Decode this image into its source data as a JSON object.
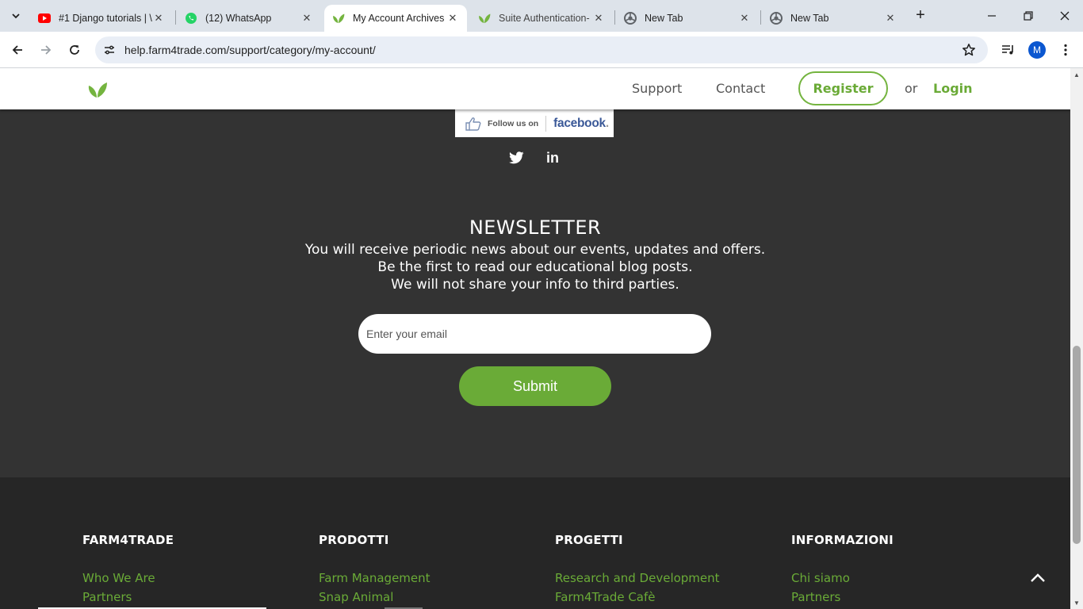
{
  "browser": {
    "tabs": [
      {
        "label": "#1 Django tutorials | \\",
        "icon": "youtube-icon"
      },
      {
        "label": "(12) WhatsApp",
        "icon": "whatsapp-icon"
      },
      {
        "label": "My Account Archives",
        "icon": "farm4trade-leaf-icon",
        "active": true
      },
      {
        "label": "Suite Authentication-",
        "icon": "farm4trade-leaf-icon"
      },
      {
        "label": "New Tab",
        "icon": "chrome-icon"
      },
      {
        "label": "New Tab",
        "icon": "chrome-icon"
      }
    ],
    "url": "help.farm4trade.com/support/category/my-account/",
    "profile_initial": "M"
  },
  "header": {
    "nav": {
      "support": "Support",
      "contact": "Contact"
    },
    "register": "Register",
    "or": "or",
    "login": "Login"
  },
  "social": {
    "facebook_follow": "Follow us on",
    "facebook_word": "facebook",
    "facebook_dot": ".",
    "linkedin_glyph": "in"
  },
  "newsletter": {
    "title": "NEWSLETTER",
    "lines": [
      "You will receive periodic news about our events, updates and offers.",
      "Be the first to read our educational blog posts.",
      "We will not share your info to third parties."
    ],
    "email_placeholder": "Enter your email",
    "submit": "Submit"
  },
  "footer": {
    "columns": [
      {
        "title": "FARM4TRADE",
        "links": [
          "Who We Are",
          "Partners"
        ]
      },
      {
        "title": "PRODOTTI",
        "links": [
          "Farm Management",
          "Snap Animal"
        ]
      },
      {
        "title": "PROGETTI",
        "links": [
          "Research and Development",
          "Farm4Trade Cafè"
        ]
      },
      {
        "title": "INFORMAZIONI",
        "links": [
          "Chi siamo",
          "Partners"
        ]
      }
    ]
  },
  "colors": {
    "brand_green": "#6aab37",
    "dark_bg": "#333333",
    "footer_bg": "#262626",
    "facebook_blue": "#3b5998"
  }
}
